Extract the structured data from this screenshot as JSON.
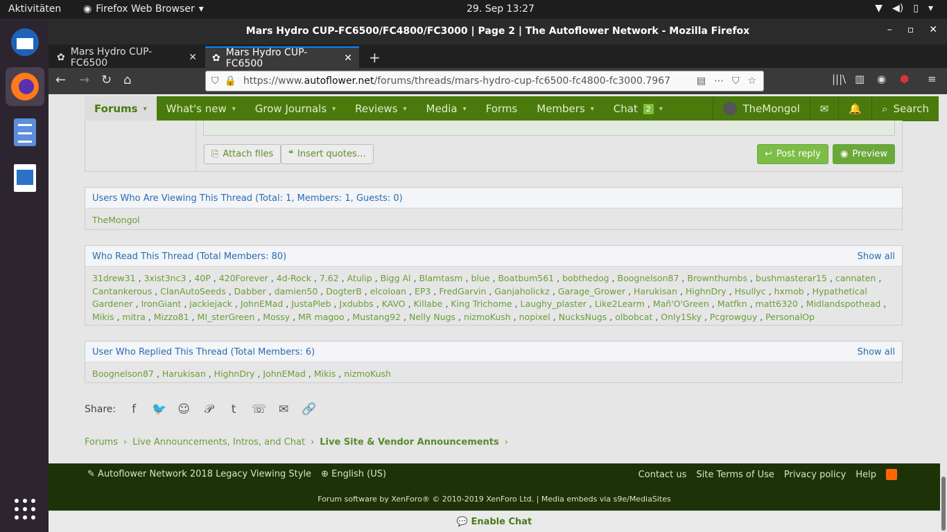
{
  "desktop": {
    "activities": "Aktivitäten",
    "app_name": "Firefox Web Browser",
    "clock": "29. Sep  13:27"
  },
  "window": {
    "title": "Mars Hydro CUP-FC6500/FC4800/FC3000 | Page 2 | The Autoflower Network - Mozilla Firefox"
  },
  "tabs": [
    {
      "label": "Mars Hydro CUP-FC6500"
    },
    {
      "label": "Mars Hydro CUP-FC6500"
    }
  ],
  "address": {
    "prefix": "https://www.",
    "domain": "autoflower.net",
    "path": "/forums/threads/mars-hydro-cup-fc6500-fc4800-fc3000.7967"
  },
  "nav": {
    "forums": "Forums",
    "whats_new": "What's new",
    "grow_journals": "Grow Journals",
    "reviews": "Reviews",
    "media": "Media",
    "forms": "Forms",
    "members": "Members",
    "chat": "Chat",
    "chat_count": "2",
    "user": "TheMongol",
    "search": "Search"
  },
  "editor": {
    "attach": "Attach files",
    "insert": "Insert quotes…",
    "post": "Post reply",
    "preview": "Preview"
  },
  "viewing": {
    "header": "Users Who Are Viewing This Thread (Total: 1, Members: 1, Guests: 0)",
    "users": "TheMongol"
  },
  "readers": {
    "header": "Who Read This Thread (Total Members: 80)",
    "show_all": "Show all",
    "names": [
      "31drew31",
      "3xist3nc3",
      "40P",
      "420Forever",
      "4d-Rock",
      "7.62",
      "Atulip",
      "Bigg Al",
      "Blamtasm",
      "blue",
      "Boatbum561",
      "bobthedog",
      "Boognelson87",
      "Brownthumbs",
      "bushmasterar15",
      "cannaten",
      "Cantankerous",
      "ClanAutoSeeds",
      "Dabber",
      "damien50",
      "DogterB",
      "elcoloan",
      "EP3",
      "FredGarvin",
      "Ganjaholickz",
      "Garage_Grower",
      "Harukisan",
      "HighnDry",
      "Hsullyc",
      "hxmob",
      "Hypathetical Gardener",
      "IronGiant",
      "jackiejack",
      "JohnEMad",
      "JustaPleb",
      "Jxdubbs",
      "KAVO",
      "Killabe",
      "King Trichome",
      "Laughy_plaster",
      "Like2Learm",
      "Mañ'O'Green",
      "Matfkn",
      "matt6320",
      "Midlandspothead",
      "Mikis",
      "mitra",
      "Mizzo81",
      "MI_sterGreen",
      "Mossy",
      "MR magoo",
      "Mustang92",
      "Nelly Nugs",
      "nizmoKush",
      "nopixel",
      "NucksNugs",
      "olbobcat",
      "Only1Sky",
      "Pcgrowguy",
      "PersonalOp"
    ]
  },
  "repliers": {
    "header": "User Who Replied This Thread (Total Members: 6)",
    "show_all": "Show all",
    "names": [
      "Boognelson87",
      "Harukisan",
      "HighnDry",
      "JohnEMad",
      "Mikis",
      "nizmoKush"
    ]
  },
  "share": {
    "label": "Share:"
  },
  "breadcrumb": {
    "forums": "Forums",
    "live": "Live Announcements, Intros, and Chat",
    "vendor": "Live Site & Vendor Announcements"
  },
  "footer": {
    "style": "Autoflower Network 2018 Legacy Viewing Style",
    "language": "English (US)",
    "contact": "Contact us",
    "terms": "Site Terms of Use",
    "privacy": "Privacy policy",
    "help": "Help",
    "copyright": "Forum software by XenForo® © 2010-2019 XenForo Ltd. | Media embeds via s9e/MediaSites"
  },
  "chatbar": {
    "label": "Enable Chat"
  }
}
